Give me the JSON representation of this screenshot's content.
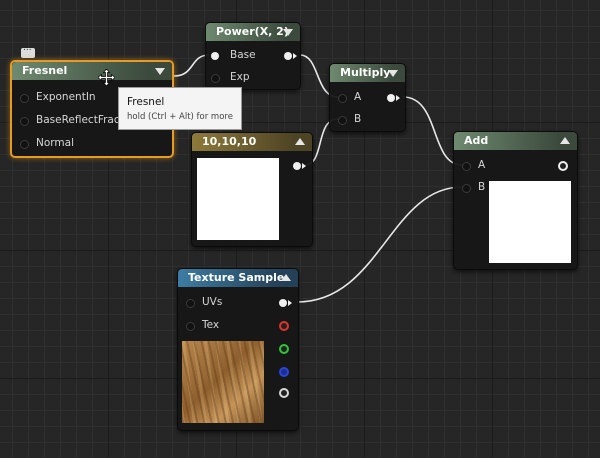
{
  "colors": {
    "selected_outline": "#e89b1f",
    "background": "#262626"
  },
  "nodes": {
    "fresnel": {
      "title": "Fresnel",
      "inputs": [
        "ExponentIn",
        "BaseReflectFractio",
        "Normal"
      ]
    },
    "power": {
      "title": "Power(X, 2)",
      "inputs": [
        "Base",
        "Exp"
      ]
    },
    "multiply": {
      "title": "Multiply",
      "inputs": [
        "A",
        "B"
      ]
    },
    "constant": {
      "title": "10,10,10"
    },
    "add": {
      "title": "Add",
      "inputs": [
        "A",
        "B"
      ]
    },
    "texture": {
      "title": "Texture Sample",
      "inputs": [
        "UVs",
        "Tex"
      ]
    }
  },
  "tooltip": {
    "title": "Fresnel",
    "hint": "hold (Ctrl + Alt) for more"
  },
  "icons": {
    "cursor": "move-cursor-icon",
    "comment": "comment-bubble-icon"
  }
}
